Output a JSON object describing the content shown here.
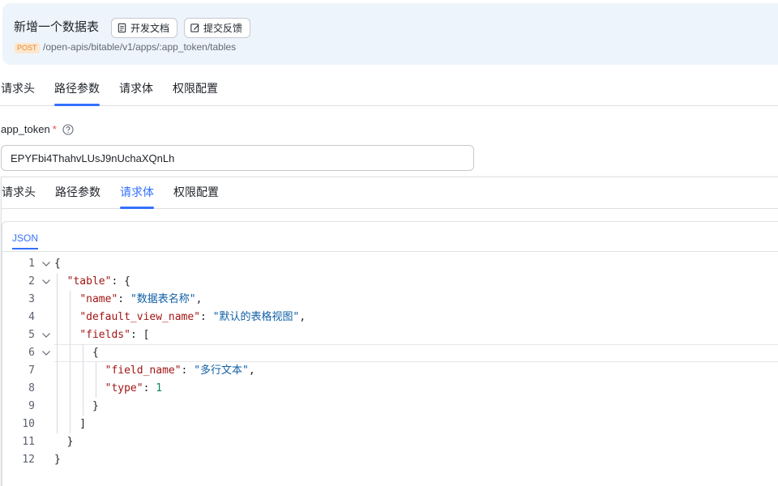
{
  "header": {
    "title": "新增一个数据表",
    "doc_button": "开发文档",
    "feedback_button": "提交反馈",
    "method": "POST",
    "path": "/open-apis/bitable/v1/apps/:app_token/tables"
  },
  "tabs_top": [
    "请求头",
    "路径参数",
    "请求体",
    "权限配置"
  ],
  "field": {
    "label": "app_token",
    "required_mark": "*",
    "value": "EPYFbi4ThahvLUsJ9nUchaXQnLh"
  },
  "tabs_panel": [
    "请求头",
    "路径参数",
    "请求体",
    "权限配置"
  ],
  "json_tab": "JSON",
  "code_lines": [
    {
      "n": "1",
      "parts": [
        [
          "p",
          "{"
        ]
      ]
    },
    {
      "n": "2",
      "parts": [
        [
          "p",
          "  "
        ],
        [
          "k",
          "\"table\""
        ],
        [
          "p",
          ": {"
        ]
      ]
    },
    {
      "n": "3",
      "parts": [
        [
          "p",
          "    "
        ],
        [
          "k",
          "\"name\""
        ],
        [
          "p",
          ": "
        ],
        [
          "s",
          "\"数据表名称\""
        ],
        [
          "p",
          ","
        ]
      ]
    },
    {
      "n": "4",
      "parts": [
        [
          "p",
          "    "
        ],
        [
          "k",
          "\"default_view_name\""
        ],
        [
          "p",
          ": "
        ],
        [
          "s",
          "\"默认的表格视图\""
        ],
        [
          "p",
          ","
        ]
      ]
    },
    {
      "n": "5",
      "parts": [
        [
          "p",
          "    "
        ],
        [
          "k",
          "\"fields\""
        ],
        [
          "p",
          ": ["
        ]
      ]
    },
    {
      "n": "6",
      "parts": [
        [
          "p",
          "      {"
        ]
      ]
    },
    {
      "n": "7",
      "parts": [
        [
          "p",
          "        "
        ],
        [
          "k",
          "\"field_name\""
        ],
        [
          "p",
          ": "
        ],
        [
          "s",
          "\"多行文本\""
        ],
        [
          "p",
          ","
        ]
      ]
    },
    {
      "n": "8",
      "parts": [
        [
          "p",
          "        "
        ],
        [
          "k",
          "\"type\""
        ],
        [
          "p",
          ": "
        ],
        [
          "n",
          "1"
        ]
      ]
    },
    {
      "n": "9",
      "parts": [
        [
          "p",
          "      }"
        ]
      ]
    },
    {
      "n": "10",
      "parts": [
        [
          "p",
          "    ]"
        ]
      ]
    },
    {
      "n": "11",
      "parts": [
        [
          "p",
          "  }"
        ]
      ]
    },
    {
      "n": "12",
      "parts": [
        [
          "p",
          "}"
        ]
      ]
    }
  ],
  "colors": {
    "accent": "#3370ff",
    "header_bg": "#eef4fb",
    "method_bg": "#fde7cf",
    "method_text": "#e8862e",
    "json_key": "#a31515",
    "json_string": "#0f5fa6",
    "json_number": "#098658"
  }
}
